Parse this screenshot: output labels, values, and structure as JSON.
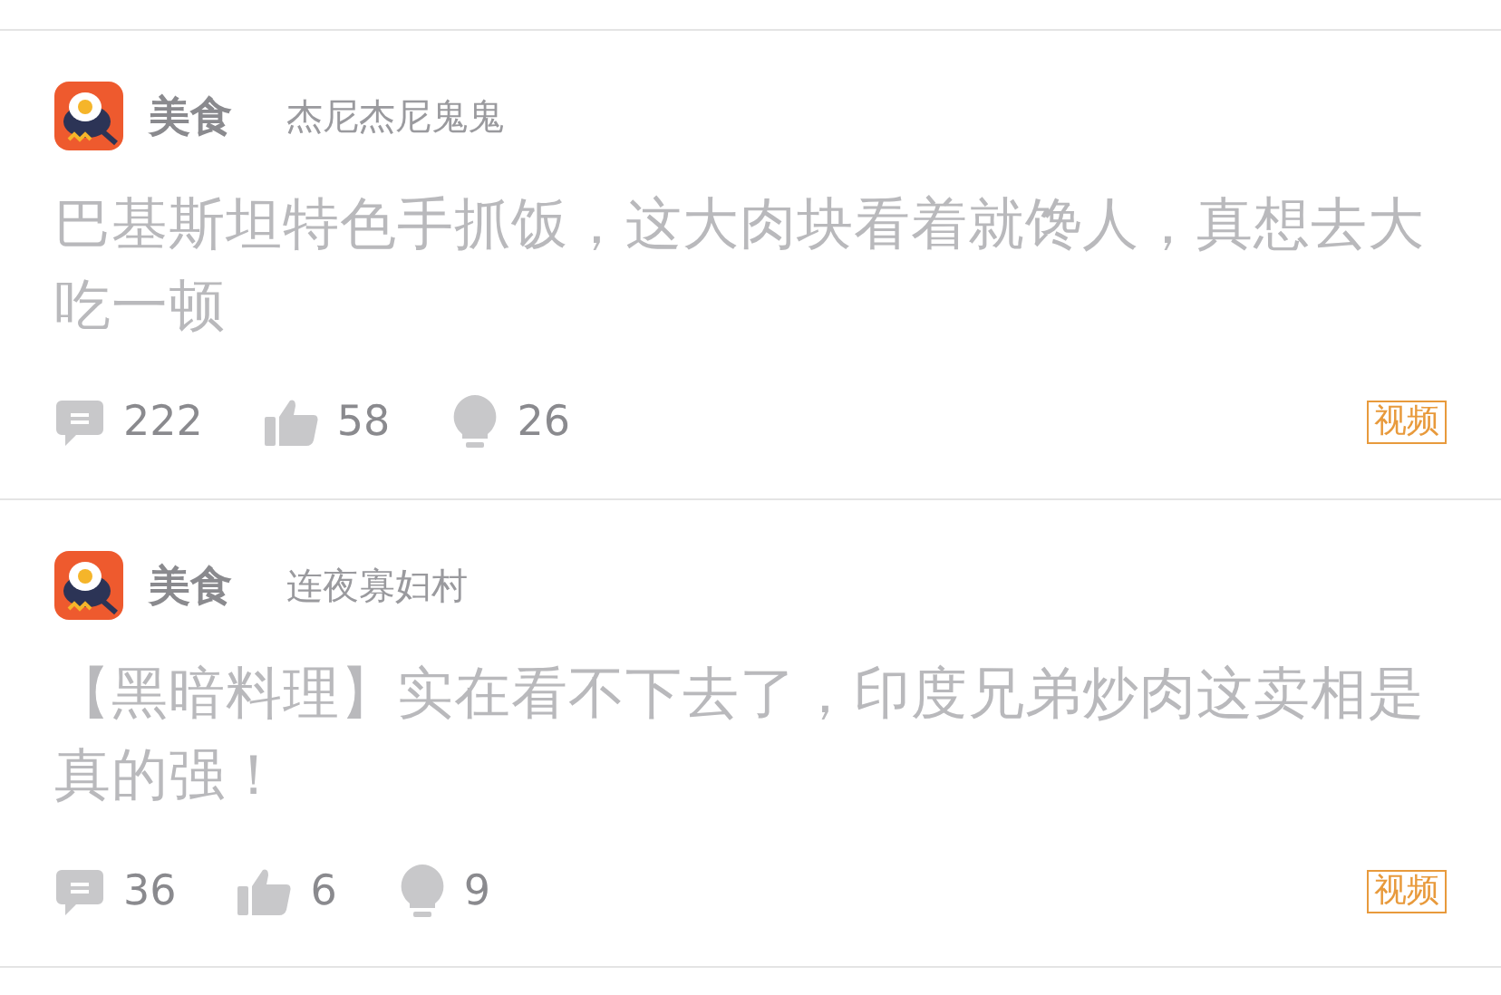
{
  "posts": [
    {
      "category": "美食",
      "author": "杰尼杰尼鬼鬼",
      "title": "巴基斯坦特色手抓饭，这大肉块看着就馋人，真想去大吃一顿",
      "comments": "222",
      "likes": "58",
      "lights": "26",
      "tag": "视频"
    },
    {
      "category": "美食",
      "author": "连夜寡妇村",
      "title": "【黑暗料理】实在看不下去了，印度兄弟炒肉这卖相是真的强！",
      "comments": "36",
      "likes": "6",
      "lights": "9",
      "tag": "视频"
    }
  ]
}
